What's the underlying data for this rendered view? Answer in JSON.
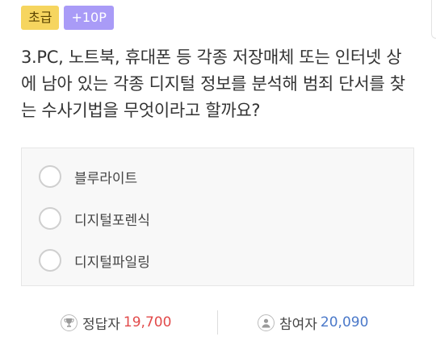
{
  "badges": {
    "level": "초급",
    "points": "+10P"
  },
  "question": {
    "text": "3.PC, 노트북, 휴대폰 등 각종 저장매체 또는 인터넷 상에 남아 있는 각종 디지털 정보를 분석해 범죄 단서를 찾는 수사기법을 무엇이라고 할까요?"
  },
  "options": [
    {
      "label": "블루라이트"
    },
    {
      "label": "디지털포렌식"
    },
    {
      "label": "디지털파일링"
    }
  ],
  "stats": {
    "correct_label": "정답자",
    "correct_value": "19,700",
    "participants_label": "참여자",
    "participants_value": "20,090"
  },
  "colors": {
    "level_badge": "#f6d55f",
    "points_badge": "#a99bf7",
    "correct_value": "#e24a4a",
    "participants_value": "#4a78c9"
  },
  "icons": {
    "correct": "trophy-icon",
    "participants": "person-icon"
  }
}
